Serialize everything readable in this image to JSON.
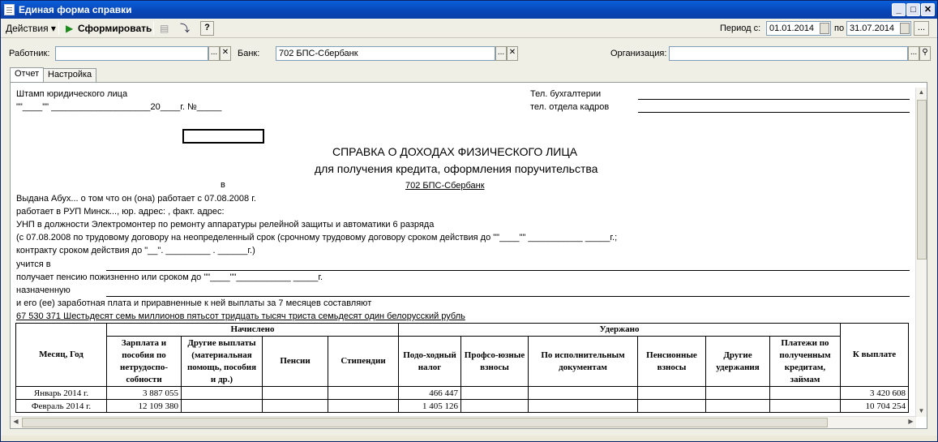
{
  "window": {
    "title": "Единая форма справки"
  },
  "toolbar": {
    "actions": "Действия",
    "generate": "Сформировать",
    "help": "?",
    "period_from_label": "Период с:",
    "period_from": "01.01.2014",
    "period_to_label": "по",
    "period_to": "31.07.2014",
    "ellipsis": "..."
  },
  "filters": {
    "worker_label": "Работник:",
    "worker_value": "",
    "bank_label": "Банк:",
    "bank_value": "702 БПС-Сбербанк",
    "org_label": "Организация:",
    "org_value": ""
  },
  "tabs": [
    "Отчет",
    "Настройка"
  ],
  "report": {
    "stamp": "Штамп юридического лица",
    "date_line": "\"\"____\"\" ____________________20____г.  №_____",
    "tel_buh": "Тел. бухгалтерии",
    "tel_hr": "тел. отдела кадров",
    "title": "СПРАВКА О ДОХОДАХ ФИЗИЧЕСКОГО ЛИЦА",
    "subtitle": "для получения кредита, оформления поручительства",
    "in": "в",
    "bank": "702 БПС-Сбербанк",
    "l1": "Выдана  Абух...  о том что он (она) работает с 07.08.2008 г.",
    "l2": "работает в РУП Минск..., юр. адрес: ,  факт. адрес:",
    "l3": "УНП   в должности  Электромонтер по ремонту аппаратуры релейной защиты и автоматики 6 разряда",
    "l4": "(с  07.08.2008  по трудовому договору на неопределенный срок  (срочному трудовому договору сроком действия  до     \"\"____\"\" ___________  _____г.;",
    "l5": "контракту сроком действия до  \"__\". _________ . ______г.)",
    "l6": "учится в",
    "l7": "получает пенсию пожизненно или сроком до  \"\"____\"\"___________  _____г.",
    "l8": "назначенную",
    "l9": "и его (ее) заработная плата и приравненные к ней выплаты за 7 месяцев составляют",
    "l10": "67 530 371 Шестьдесят семь миллионов пятьсот тридцать тысяч триста семьдесят один белорусский рубль"
  },
  "table": {
    "month_header": "Месяц, Год",
    "accrued": "Начислено",
    "withheld": "Удержано",
    "to_pay": "К выплате",
    "cols": [
      "Зарплата и пособия по нетрудоспо-собности",
      "Другие выплаты (материальная помощь, пособия и др.)",
      "Пенсии",
      "Стипендии",
      "Подо-ходный налог",
      "Профсо-юзные взносы",
      "По исполнительным документам",
      "Пенсионные взносы",
      "Другие удержания",
      "Платежи по полученным кредитам, займам"
    ],
    "rows": [
      {
        "month": "Январь 2014 г.",
        "salary": "3 887 055",
        "tax": "466 447",
        "pay": "3 420 608"
      },
      {
        "month": "Февраль 2014 г.",
        "salary": "12 109 380",
        "tax": "1 405 126",
        "pay": "10 704 254"
      }
    ]
  }
}
